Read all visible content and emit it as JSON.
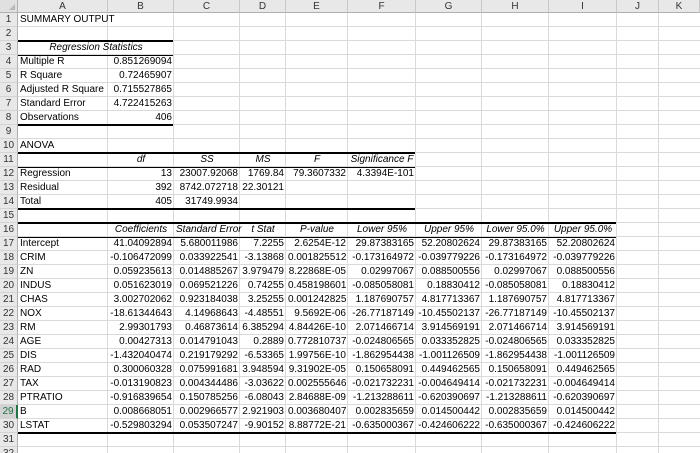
{
  "columns": [
    "A",
    "B",
    "C",
    "D",
    "E",
    "F",
    "G",
    "H",
    "I",
    "J",
    "K"
  ],
  "rows": [
    "1",
    "2",
    "3",
    "4",
    "5",
    "6",
    "7",
    "8",
    "9",
    "10",
    "11",
    "12",
    "13",
    "14",
    "15",
    "16",
    "17",
    "18",
    "19",
    "20",
    "21",
    "22",
    "23",
    "24",
    "25",
    "26",
    "27",
    "28",
    "29",
    "30",
    "31",
    "32"
  ],
  "selected_row": "29",
  "summary": {
    "title": "SUMMARY OUTPUT",
    "reg_stats_header": "Regression Statistics",
    "stats": [
      {
        "label": "Multiple R",
        "value": "0.851269094"
      },
      {
        "label": "R Square",
        "value": "0.72465907"
      },
      {
        "label": "Adjusted R Square",
        "value": "0.715527865"
      },
      {
        "label": "Standard Error",
        "value": "4.722415263"
      },
      {
        "label": "Observations",
        "value": "406"
      }
    ]
  },
  "anova": {
    "title": "ANOVA",
    "headers": [
      "df",
      "SS",
      "MS",
      "F",
      "Significance F"
    ],
    "rows": [
      {
        "label": "Regression",
        "df": "13",
        "ss": "23007.92068",
        "ms": "1769.84",
        "f": "79.3607332",
        "sig": "4.3394E-101"
      },
      {
        "label": "Residual",
        "df": "392",
        "ss": "8742.072718",
        "ms": "22.30121",
        "f": "",
        "sig": ""
      },
      {
        "label": "Total",
        "df": "405",
        "ss": "31749.9934",
        "ms": "",
        "f": "",
        "sig": ""
      }
    ]
  },
  "coef": {
    "headers": [
      "Coefficients",
      "Standard Error",
      "t Stat",
      "P-value",
      "Lower 95%",
      "Upper 95%",
      "Lower 95.0%",
      "Upper 95.0%"
    ],
    "rows": [
      {
        "label": "Intercept",
        "v": [
          "41.04092894",
          "5.680011986",
          "7.2255",
          "2.6254E-12",
          "29.87383165",
          "52.20802624",
          "29.87383165",
          "52.20802624"
        ]
      },
      {
        "label": "CRIM",
        "v": [
          "-0.106472099",
          "0.033922541",
          "-3.13868",
          "0.001825512",
          "-0.173164972",
          "-0.039779226",
          "-0.173164972",
          "-0.039779226"
        ]
      },
      {
        "label": "ZN",
        "v": [
          "0.059235613",
          "0.014885267",
          "3.979479",
          "8.22868E-05",
          "0.02997067",
          "0.088500556",
          "0.02997067",
          "0.088500556"
        ]
      },
      {
        "label": "INDUS",
        "v": [
          "0.051623019",
          "0.069521226",
          "0.74255",
          "0.458198601",
          "-0.085058081",
          "0.18830412",
          "-0.085058081",
          "0.18830412"
        ]
      },
      {
        "label": "CHAS",
        "v": [
          "3.002702062",
          "0.923184038",
          "3.25255",
          "0.001242825",
          "1.187690757",
          "4.817713367",
          "1.187690757",
          "4.817713367"
        ]
      },
      {
        "label": "NOX",
        "v": [
          "-18.61344643",
          "4.14968643",
          "-4.48551",
          "9.5692E-06",
          "-26.77187149",
          "-10.45502137",
          "-26.77187149",
          "-10.45502137"
        ]
      },
      {
        "label": "RM",
        "v": [
          "2.99301793",
          "0.46873614",
          "6.385294",
          "4.84426E-10",
          "2.071466714",
          "3.914569191",
          "2.071466714",
          "3.914569191"
        ]
      },
      {
        "label": "AGE",
        "v": [
          "0.00427313",
          "0.014791043",
          "0.2889",
          "0.772810737",
          "-0.024806565",
          "0.033352825",
          "-0.024806565",
          "0.033352825"
        ]
      },
      {
        "label": "DIS",
        "v": [
          "-1.432040474",
          "0.219179292",
          "-6.53365",
          "1.99756E-10",
          "-1.862954438",
          "-1.001126509",
          "-1.862954438",
          "-1.001126509"
        ]
      },
      {
        "label": "RAD",
        "v": [
          "0.300060328",
          "0.075991681",
          "3.948594",
          "9.31902E-05",
          "0.150658091",
          "0.449462565",
          "0.150658091",
          "0.449462565"
        ]
      },
      {
        "label": "TAX",
        "v": [
          "-0.013190823",
          "0.004344486",
          "-3.03622",
          "0.002555646",
          "-0.021732231",
          "-0.004649414",
          "-0.021732231",
          "-0.004649414"
        ]
      },
      {
        "label": "PTRATIO",
        "v": [
          "-0.916839654",
          "0.150785256",
          "-6.08043",
          "2.84688E-09",
          "-1.213288611",
          "-0.620390697",
          "-1.213288611",
          "-0.620390697"
        ]
      },
      {
        "label": "B",
        "v": [
          "0.008668051",
          "0.002966577",
          "2.921903",
          "0.003680407",
          "0.002835659",
          "0.014500442",
          "0.002835659",
          "0.014500442"
        ]
      },
      {
        "label": "LSTAT",
        "v": [
          "-0.529803294",
          "0.053507247",
          "-9.90152",
          "8.88772E-21",
          "-0.635000367",
          "-0.424606222",
          "-0.635000367",
          "-0.424606222"
        ]
      }
    ]
  }
}
